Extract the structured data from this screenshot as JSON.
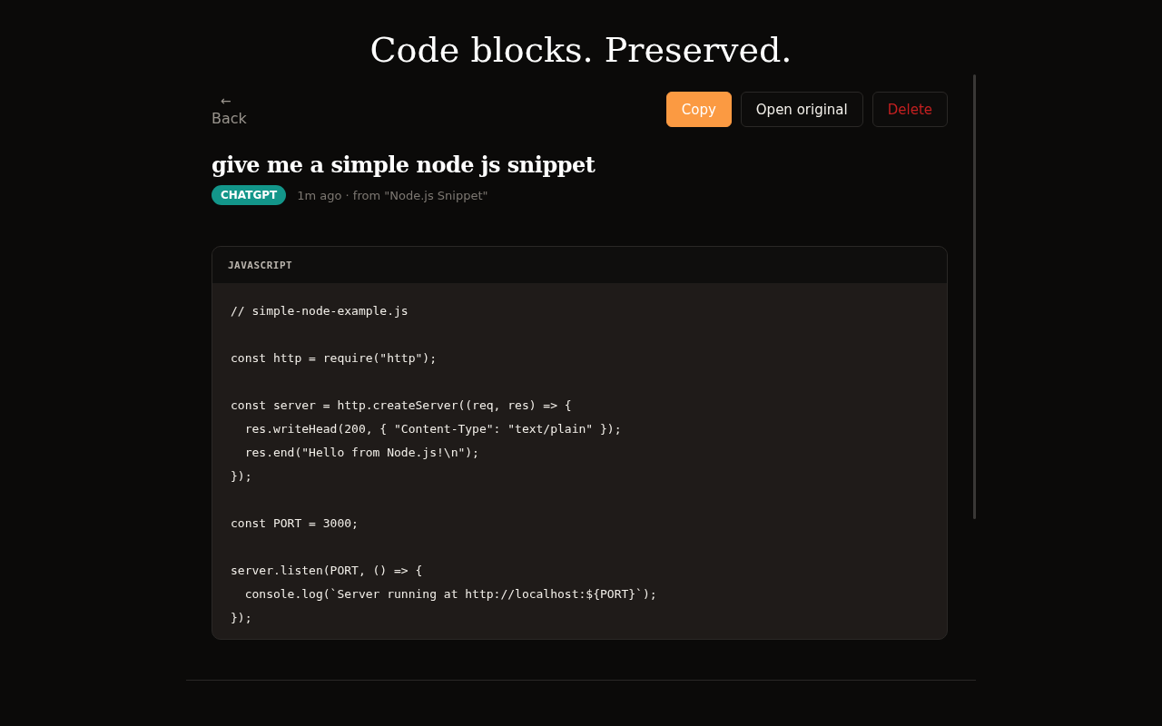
{
  "headline": "Code blocks. Preserved.",
  "back": {
    "arrow": "←",
    "label": "Back"
  },
  "actions": [
    {
      "label": "Copy",
      "kind": "primary"
    },
    {
      "label": "Open original",
      "kind": "secondary"
    },
    {
      "label": "Delete",
      "kind": "danger"
    }
  ],
  "title": "give me a simple node js snippet",
  "source_tag": {
    "label": "CHATGPT",
    "color": "#13968a"
  },
  "meta": "1m ago · from \"Node.js Snippet\"",
  "code_block": {
    "language": "JAVASCRIPT",
    "code": "// simple-node-example.js\n\nconst http = require(\"http\");\n\nconst server = http.createServer((req, res) => {\n  res.writeHead(200, { \"Content-Type\": \"text/plain\" });\n  res.end(\"Hello from Node.js!\\n\");\n});\n\nconst PORT = 3000;\n\nserver.listen(PORT, () => {\n  console.log(`Server running at http://localhost:${PORT}`);\n});"
  }
}
